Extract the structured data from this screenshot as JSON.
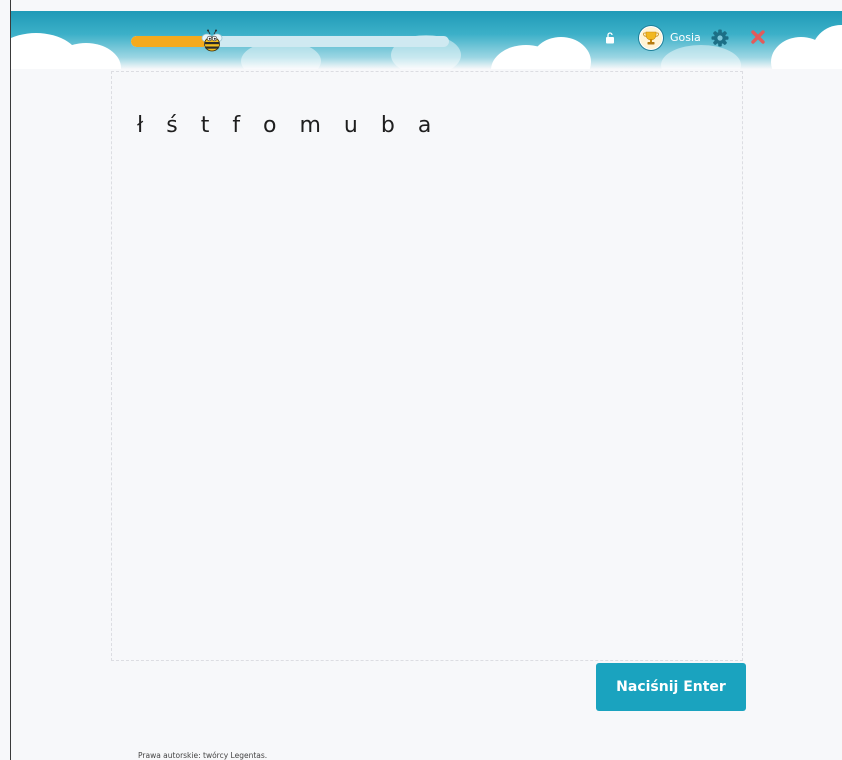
{
  "header": {
    "progress": {
      "fraction": 0.23
    },
    "icons": {
      "bee": "bee-icon",
      "lock": "unlock-icon",
      "settings": "gear-icon",
      "close": "close-icon",
      "avatar": "trophy-avatar"
    },
    "user": {
      "name": "Gosia"
    },
    "colors": {
      "header_top": "#1f9ab7",
      "progress_fill": "#f4aa1e",
      "close": "#e25b5b"
    }
  },
  "exercise": {
    "letters": "ł ś t f o m u b a"
  },
  "actions": {
    "enter_label": "Naciśnij Enter",
    "button_color": "#1aa3bf"
  },
  "footer": {
    "copyright": "Prawa autorskie: twórcy Legentas."
  }
}
